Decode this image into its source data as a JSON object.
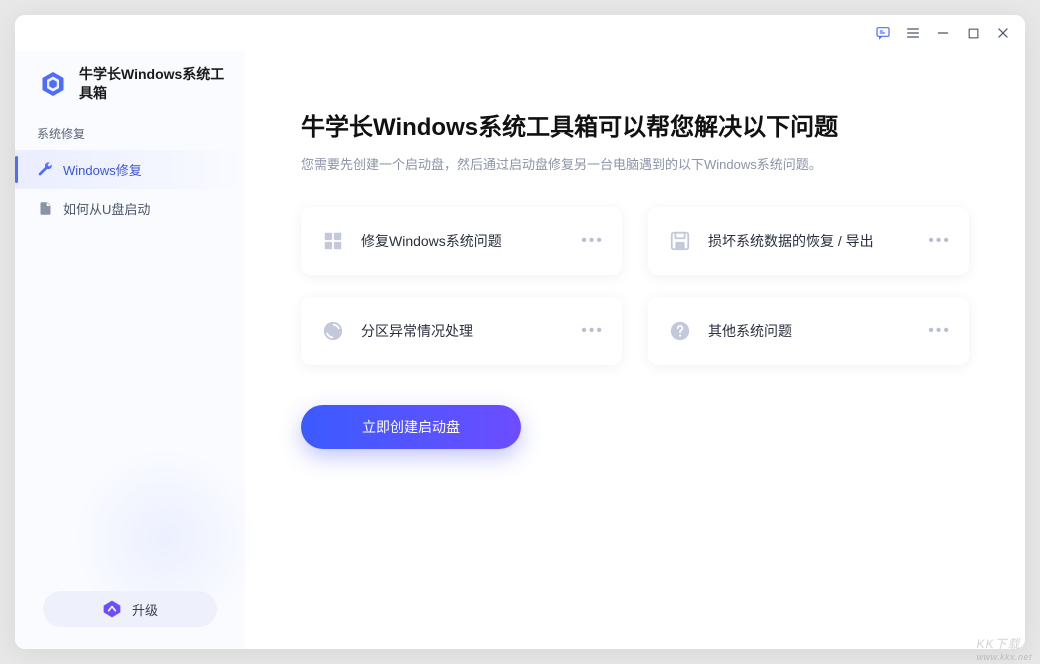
{
  "brand": {
    "title": "牛学长Windows系统工具箱"
  },
  "sidebar": {
    "section_label": "系统修复",
    "items": [
      {
        "label": "Windows修复",
        "icon": "wrench-icon"
      },
      {
        "label": "如何从U盘启动",
        "icon": "file-icon"
      }
    ],
    "upgrade_label": "升级"
  },
  "main": {
    "headline": "牛学长Windows系统工具箱可以帮您解决以下问题",
    "subtitle": "您需要先创建一个启动盘，然后通过启动盘修复另一台电脑遇到的以下Windows系统问题。",
    "cards": [
      {
        "label": "修复Windows系统问题",
        "icon": "grid-icon"
      },
      {
        "label": "损坏系统数据的恢复 / 导出",
        "icon": "save-icon"
      },
      {
        "label": "分区异常情况处理",
        "icon": "rotate-icon"
      },
      {
        "label": "其他系统问题",
        "icon": "question-icon"
      }
    ],
    "cta_label": "立即创建启动盘"
  },
  "watermark": {
    "big": "KK下载",
    "small": "www.kkx.net"
  }
}
